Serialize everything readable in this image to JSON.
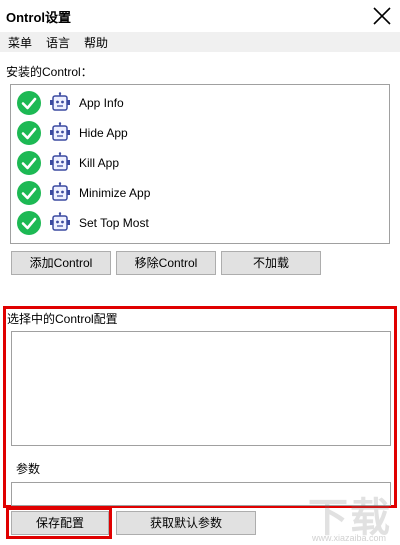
{
  "window": {
    "title": "Ontrol设置"
  },
  "menu": {
    "items": [
      "菜单",
      "语言",
      "帮助"
    ]
  },
  "installed": {
    "label": "安装的Control：",
    "items": [
      "App Info",
      "Hide App",
      "Kill App",
      "Minimize App",
      "Set Top Most"
    ]
  },
  "buttons": {
    "add": "添加Control",
    "remove": "移除Control",
    "no_load": "不加载"
  },
  "config": {
    "label": "选择中的Control配置"
  },
  "params": {
    "label": "参数"
  },
  "footer": {
    "save": "保存配置",
    "defaults": "获取默认参数"
  },
  "colors": {
    "check": "#1db954",
    "robot": "#3b4aa0",
    "highlight": "#e00000"
  },
  "icons": {
    "check": "check-circle-icon",
    "robot": "robot-icon",
    "close": "close-icon"
  },
  "watermark": {
    "text": "下载",
    "sub": "www.xiazaiba.com"
  }
}
